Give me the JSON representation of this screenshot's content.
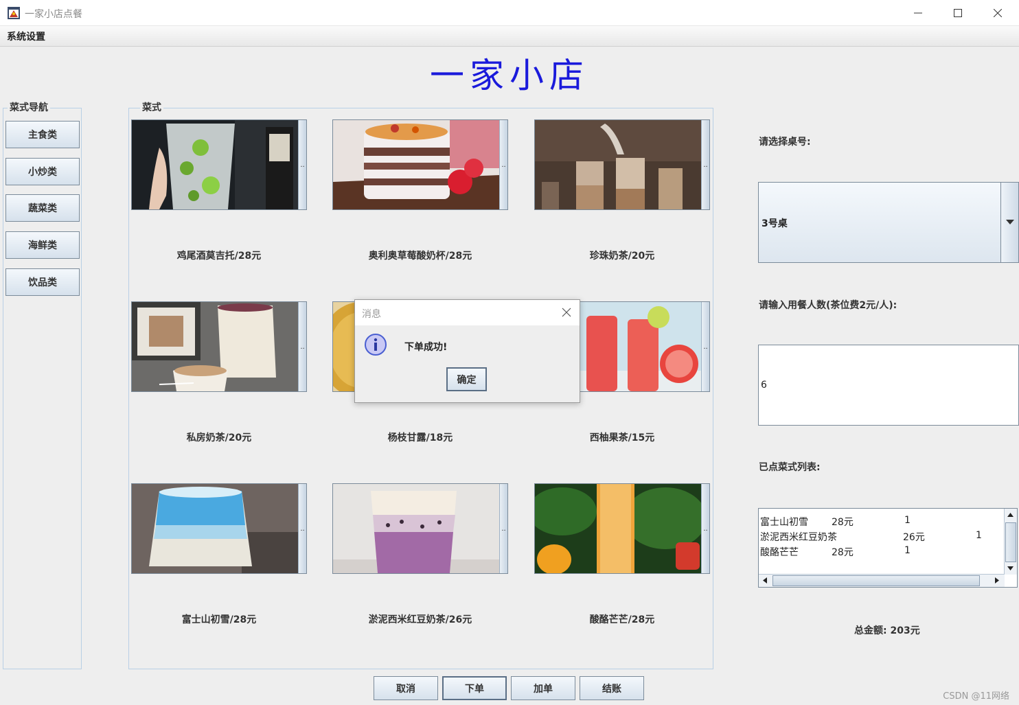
{
  "window": {
    "title": "一家小店点餐"
  },
  "menu": {
    "system_settings": "系统设置"
  },
  "shop_title": "一家小店",
  "nav": {
    "legend": "菜式导航",
    "items": [
      "主食类",
      "小炒类",
      "蔬菜类",
      "海鲜类",
      "饮品类"
    ]
  },
  "dishes": {
    "legend": "菜式",
    "items": [
      {
        "label": "鸡尾酒莫吉托/28元"
      },
      {
        "label": "奥利奥草莓酸奶杯/28元"
      },
      {
        "label": "珍珠奶茶/20元"
      },
      {
        "label": "私房奶茶/20元"
      },
      {
        "label": "杨枝甘露/18元"
      },
      {
        "label": "西柚果茶/15元"
      },
      {
        "label": "富士山初雪/28元"
      },
      {
        "label": "淤泥西米红豆奶茶/26元"
      },
      {
        "label": "酸酪芒芒/28元"
      }
    ],
    "scroll_glyph": ".."
  },
  "right_panel": {
    "table_label": "请选择桌号:",
    "table_value": "3号桌",
    "people_label": "请输入用餐人数(茶位费2元/人):",
    "people_value": "6",
    "ordered_label": "已点菜式列表:",
    "ordered": [
      {
        "name": "富士山初雪",
        "price": "28元",
        "qty": "1"
      },
      {
        "name": "淤泥西米红豆奶茶",
        "price": "26元",
        "qty": "1"
      },
      {
        "name": "酸酪芒芒",
        "price": "28元",
        "qty": "1"
      }
    ],
    "total_label": "总金额:",
    "total_value": "203元"
  },
  "actions": {
    "cancel": "取消",
    "order": "下单",
    "add": "加单",
    "checkout": "结账"
  },
  "dialog": {
    "title": "消息",
    "message": "下单成功!",
    "ok": "确定"
  },
  "watermark": "CSDN @11网络",
  "colors": {
    "shop_title": "#1a1adb",
    "border_accent": "#b8cfe5",
    "info_icon": "#4a5fd1"
  }
}
